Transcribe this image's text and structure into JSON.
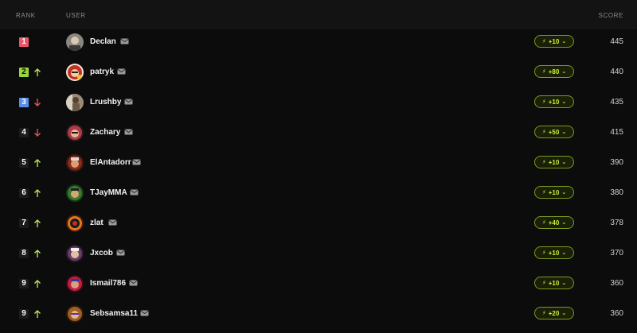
{
  "header": {
    "rank": "RANK",
    "user": "USER",
    "score": "SCORE"
  },
  "colors": {
    "rank1": "#e8566a",
    "rank2": "#9bd53e",
    "rank3": "#5a8fe8",
    "trend_up": "#b6e35a",
    "trend_down": "#e05555",
    "pill_text": "#c8f03a"
  },
  "rows": [
    {
      "rank": "1",
      "trend": "",
      "user": "Declan",
      "points": "+10",
      "score": "445"
    },
    {
      "rank": "2",
      "trend": "up",
      "user": "patryk",
      "points": "+80",
      "score": "440"
    },
    {
      "rank": "3",
      "trend": "down",
      "user": "Lrushby",
      "points": "+10",
      "score": "435"
    },
    {
      "rank": "4",
      "trend": "down",
      "user": "Zachary",
      "points": "+50",
      "score": "415"
    },
    {
      "rank": "5",
      "trend": "up",
      "user": "ElAntadorr",
      "points": "+10",
      "score": "390"
    },
    {
      "rank": "6",
      "trend": "up",
      "user": "TJayMMA",
      "points": "+10",
      "score": "380"
    },
    {
      "rank": "7",
      "trend": "up",
      "user": "zlat",
      "points": "+40",
      "score": "378"
    },
    {
      "rank": "8",
      "trend": "up",
      "user": "Jxcob",
      "points": "+10",
      "score": "370"
    },
    {
      "rank": "9",
      "trend": "up",
      "user": "Ismail786",
      "points": "+10",
      "score": "360"
    },
    {
      "rank": "9",
      "trend": "up",
      "user": "Sebsamsa11",
      "points": "+20",
      "score": "360"
    }
  ],
  "icons": {
    "mail": "mail-icon",
    "bolt": "bolt-icon",
    "chevron": "chevron-down-icon",
    "trend_up": "arrow-up-icon",
    "trend_down": "arrow-down-icon"
  }
}
